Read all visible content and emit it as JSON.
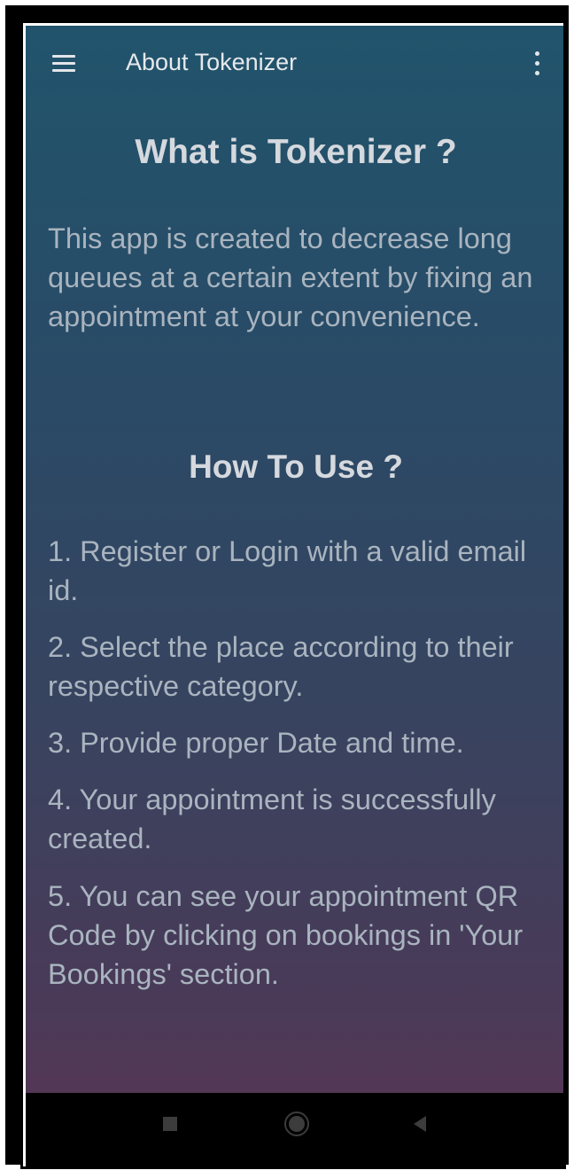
{
  "appbar": {
    "title": "About Tokenizer",
    "menu_icon": "hamburger-menu-icon",
    "more_icon": "more-vert-icon"
  },
  "about": {
    "heading": "What is Tokenizer ?",
    "description": "This app is created to decrease long queues at a certain extent by fixing an appointment at your convenience."
  },
  "usage": {
    "heading": "How To Use ?",
    "steps": [
      "1. Register or Login with a valid email id.",
      "2. Select the place according to their respective category.",
      "3. Provide proper Date and time.",
      "4. Your appointment is successfully created.",
      "5. You can see your appointment QR Code by clicking on bookings in 'Your Bookings' section."
    ]
  },
  "navbar": {
    "icons": [
      "recents-square-icon",
      "home-circle-icon",
      "back-triangle-icon"
    ]
  },
  "colors": {
    "gradient_top": "#21546c",
    "gradient_bottom": "#533856",
    "heading_text": "#d5d9de",
    "body_text": "#a9b4bf",
    "navbar_bg": "#000000"
  }
}
